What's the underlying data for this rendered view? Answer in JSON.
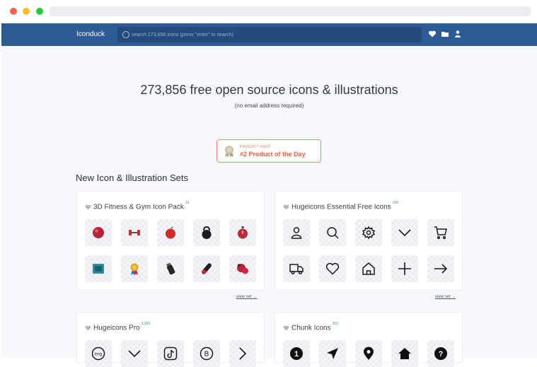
{
  "site": {
    "logo": "Iconduck",
    "search_placeholder": "search 273,856 icons (press \"enter\" to search)",
    "header_icons": [
      "heart-icon",
      "folder-icon",
      "user-icon"
    ]
  },
  "hero": {
    "title": "273,856 free open source icons & illustrations",
    "subtitle": "(no email address required)"
  },
  "badge": {
    "small": "PRODUCT HUNT",
    "main": "#2 Product of the Day"
  },
  "section_title": "New Icon & Illustration Sets",
  "cards": [
    {
      "title": "3D Fitness & Gym Icon Pack",
      "count": "16",
      "icons": [
        "ball-icon",
        "dumbbell-icon",
        "apple-icon",
        "kettlebell-icon",
        "stopwatch-icon",
        "scale-icon",
        "medal-icon",
        "bottle-icon",
        "roller-icon",
        "boxing-glove-icon"
      ],
      "view_label": "view set →"
    },
    {
      "title": "Hugeicons Essential Free Icons",
      "count": "108",
      "icons": [
        "user-icon",
        "search-icon",
        "gear-icon",
        "chevron-down-icon",
        "cart-icon",
        "truck-icon",
        "heart-icon",
        "home-icon",
        "plus-icon",
        "arrow-right-icon"
      ],
      "view_label": "view set →"
    },
    {
      "title": "Hugeicons Pro",
      "count": "3,369",
      "icons": [
        "img-badge-icon",
        "chevron-down-icon",
        "tiktok-icon",
        "bitcoin-icon",
        "chevron-right-icon"
      ]
    },
    {
      "title": "Chunk Icons",
      "count": "302",
      "icons": [
        "number-one-icon",
        "navigation-icon",
        "map-pin-icon",
        "home-solid-icon",
        "question-icon"
      ]
    }
  ],
  "colors": {
    "header_bg": "#2d5b95",
    "page_bg": "#f6f8fb",
    "badge_accent": "#e4643f",
    "count_green": "#3c9a62"
  }
}
